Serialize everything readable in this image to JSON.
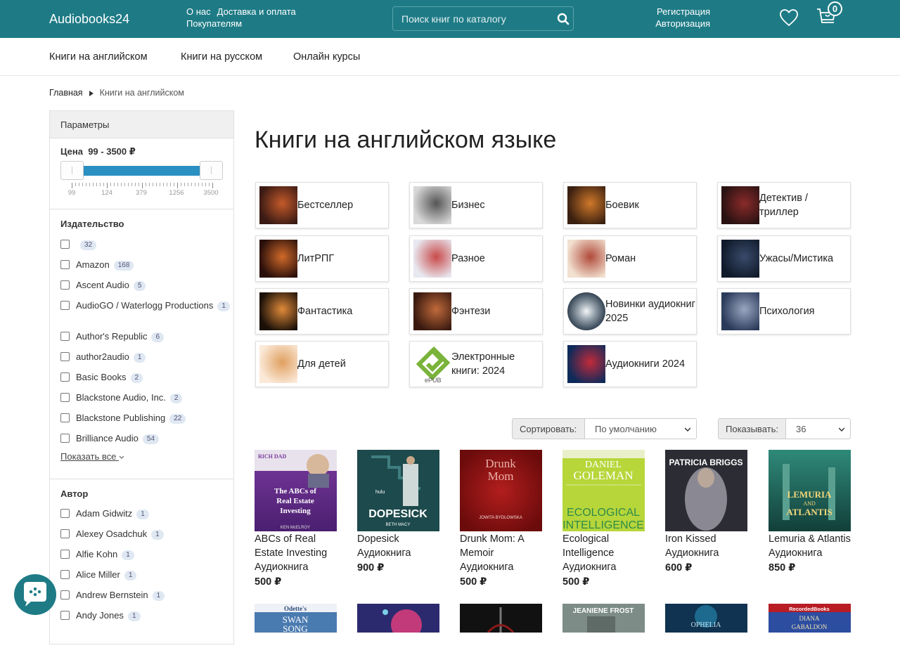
{
  "header": {
    "logo": "Audiobooks24",
    "links_row1": [
      "О нас",
      "Доставка и оплата"
    ],
    "links_row2": [
      "Покупателям"
    ],
    "search_placeholder": "Поиск книг по каталогу",
    "register": "Регистрация",
    "login": "Авторизация",
    "cart_count": "0",
    "icons": {
      "search": "search-icon",
      "wishlist": "heart-icon",
      "cart": "cart-icon"
    }
  },
  "nav": [
    "Книги на английском",
    "Книги на русском",
    "Онлайн курсы"
  ],
  "breadcrumb": {
    "home": "Главная",
    "current": "Книги на английском"
  },
  "sidebar": {
    "title": "Параметры",
    "price": {
      "label": "Цена",
      "range": "99 - 3500 ₽",
      "ticks": [
        "99",
        "124",
        "379",
        "1256",
        "3500"
      ]
    },
    "publisher": {
      "title": "Издательство",
      "items": [
        {
          "label": "",
          "count": "32"
        },
        {
          "label": "Amazon",
          "count": "168"
        },
        {
          "label": "Ascent Audio",
          "count": "5"
        },
        {
          "label": "AudioGO / Waterlogg Productions",
          "count": "1"
        },
        {
          "label": "Author's Republic",
          "count": "6"
        },
        {
          "label": "author2audio",
          "count": "1"
        },
        {
          "label": "Basic Books",
          "count": "2"
        },
        {
          "label": "Blackstone Audio, Inc.",
          "count": "2"
        },
        {
          "label": "Blackstone Publishing",
          "count": "22"
        },
        {
          "label": "Brilliance Audio",
          "count": "54"
        }
      ],
      "show_all": "Показать все"
    },
    "author": {
      "title": "Автор",
      "items": [
        {
          "label": "Adam Gidwitz",
          "count": "1"
        },
        {
          "label": "Alexey Osadchuk",
          "count": "1"
        },
        {
          "label": "Alfie Kohn",
          "count": "1"
        },
        {
          "label": "Alice Miller",
          "count": "1"
        },
        {
          "label": "Andrew Bernstein",
          "count": "1"
        },
        {
          "label": "Andy Jones",
          "count": "1"
        }
      ]
    }
  },
  "main": {
    "title": "Книги на английском языке",
    "categories": [
      "Бестселлер",
      "Бизнес",
      "Боевик",
      "Детектив / триллер",
      "ЛитРПГ",
      "Разное",
      "Роман",
      "Ужасы/Мистика",
      "Фантастика",
      "Фэнтези",
      "Новинки аудиокниг 2025",
      "Психология",
      "Для детей",
      "Электронные книги: 2024",
      "Аудиокниги 2024"
    ],
    "sort": {
      "label": "Сортировать:",
      "value": "По умолчанию"
    },
    "show": {
      "label": "Показывать:",
      "value": "36"
    },
    "products": [
      {
        "name": "ABCs of Real Estate Investing Аудиокнига",
        "price": "500 ₽"
      },
      {
        "name": "Dopesick Аудиокнига",
        "price": "900 ₽"
      },
      {
        "name": "Drunk Mom: A Memoir Аудиокнига",
        "price": "500 ₽"
      },
      {
        "name": "Ecological Intelligence Аудиокнига",
        "price": "500 ₽"
      },
      {
        "name": "Iron Kissed Аудиокнига",
        "price": "600 ₽"
      },
      {
        "name": "Lemuria & Atlantis Аудиокнига",
        "price": "850 ₽"
      }
    ],
    "covers": {
      "abcs": [
        "RICH DAD",
        "The ABCs of Real Estate Investing",
        "KEN McELROY"
      ],
      "dopesick": [
        "hulu",
        "DOPESICK",
        "BETH MACY"
      ],
      "drunk": [
        "Drunk",
        "Mom",
        "JOWITA BYDLOWSKA"
      ],
      "eco": [
        "DANIEL",
        "GOLEMAN",
        "ECOLOGICAL",
        "INTELLIGENCE"
      ],
      "iron": [
        "PATRICIA BRIGGS"
      ],
      "lemuria": [
        "LEMURIA",
        "AND",
        "ATLANTIS"
      ],
      "swan": [
        "Odette's",
        "SWAN",
        "SONG"
      ],
      "jeaniene": [
        "JEANIENE FROST"
      ],
      "ophelia": [
        "OPHELIA"
      ],
      "recorded": [
        "RecordedBooks",
        "DIANA",
        "GABALDON"
      ]
    }
  }
}
